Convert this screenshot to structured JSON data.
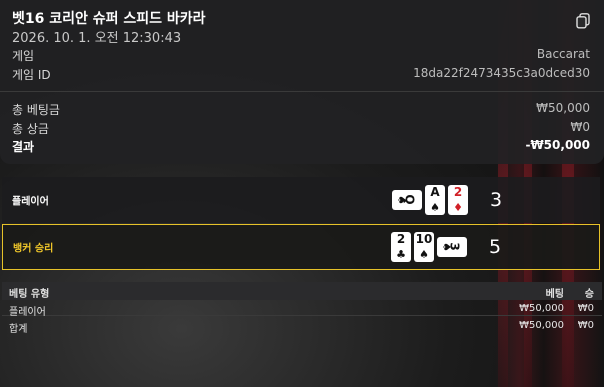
{
  "header": {
    "title": "벳16 코리안 슈퍼 스피드 바카라",
    "datetime": "2026. 10. 1. 오전 12:30:43"
  },
  "info": {
    "game_label": "게임",
    "game_value": "Baccarat",
    "game_id_label": "게임 ID",
    "game_id_value": "18da22f2473435c3a0dced30"
  },
  "summary": {
    "total_bet_label": "총 베팅금",
    "total_bet_value": "₩50,000",
    "total_win_label": "총 상금",
    "total_win_value": "₩0",
    "result_label": "결과",
    "result_value": "-₩50,000"
  },
  "results": {
    "player": {
      "label": "플레이어",
      "score": "3",
      "cards": [
        {
          "rank": "Q",
          "suit": "♠",
          "color": "#111111",
          "sideways": true
        },
        {
          "rank": "A",
          "suit": "♠",
          "color": "#111111",
          "sideways": false
        },
        {
          "rank": "2",
          "suit": "♦",
          "color": "#d12027",
          "sideways": false
        }
      ]
    },
    "banker": {
      "label": "뱅커 승리",
      "score": "5",
      "cards": [
        {
          "rank": "2",
          "suit": "♣",
          "color": "#111111",
          "sideways": false
        },
        {
          "rank": "10",
          "suit": "♠",
          "color": "#111111",
          "sideways": false
        },
        {
          "rank": "3",
          "suit": "♠",
          "color": "#111111",
          "sideways": true
        }
      ]
    },
    "highlight_color": "#e6c229"
  },
  "table": {
    "headers": [
      "베팅 유형",
      "베팅",
      "승"
    ],
    "rows": [
      [
        "플레이어",
        "₩50,000",
        "₩0"
      ],
      [
        "합계",
        "₩50,000",
        "₩0"
      ]
    ]
  }
}
